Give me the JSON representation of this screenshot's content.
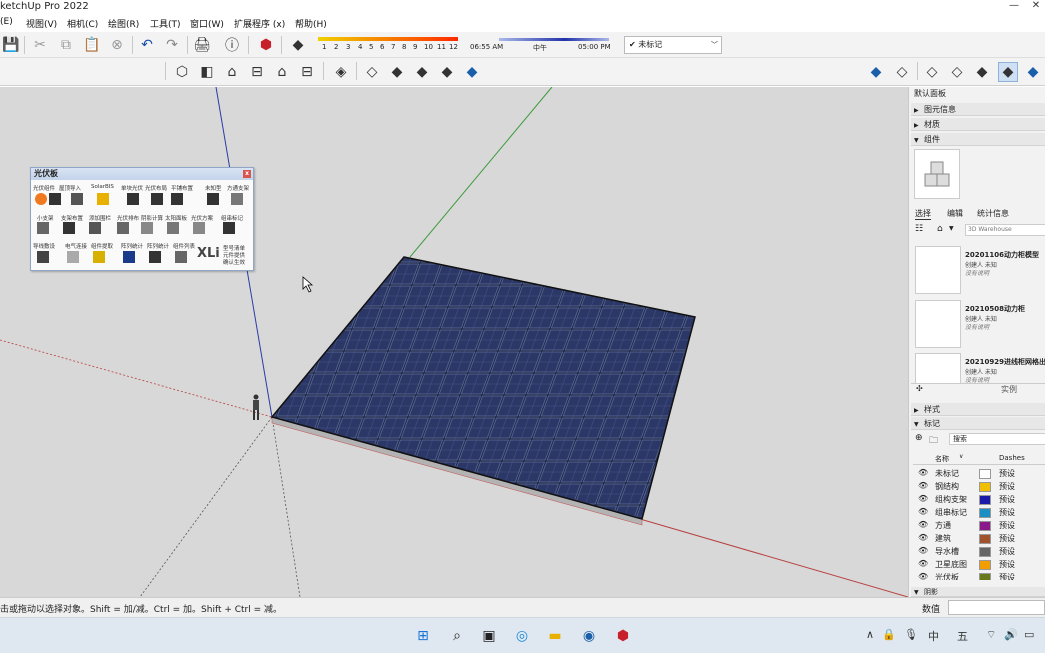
{
  "window": {
    "title": "ketchUp Pro 2022",
    "minimize": "—",
    "close": "✕"
  },
  "menu": [
    "(E)",
    "视图(V)",
    "相机(C)",
    "绘图(R)",
    "工具(T)",
    "窗口(W)",
    "扩展程序 (x)",
    "帮助(H)"
  ],
  "toolbar": {
    "months": [
      "1",
      "2",
      "3",
      "4",
      "5",
      "6",
      "7",
      "8",
      "9",
      "10",
      "11",
      "12"
    ],
    "time_start": "06:55 AM",
    "time_mid": "中午",
    "time_end": "05:00 PM",
    "tag_dropdown_value": "未标记",
    "tag_check": "✔"
  },
  "pv_panel": {
    "title": "光伏板",
    "close": "x",
    "row1_labels": [
      "光伏组件",
      "屋顶导入",
      "SolarBIS",
      "单块光伏",
      "光伏布局",
      "平铺布置",
      "未知型",
      "方通支架"
    ],
    "row2_labels": [
      "小支架",
      "支架布置",
      "添加围栏",
      "光伏排布",
      "阴影计算",
      "太阳面板",
      "光伏方案",
      "组串标记"
    ],
    "row3_labels": [
      "导线敷设",
      "电气连接",
      "组件提取",
      "阵列统计",
      "阵列统计",
      "组件列表"
    ],
    "xli_text": "XLi",
    "xli_side": [
      "型号清单",
      "元件提供",
      "确认生效"
    ]
  },
  "tray": {
    "default_tray": "默认面板",
    "entity_info": "图元信息",
    "materials": "材质",
    "components": "组件",
    "tabs": {
      "select": "选择",
      "edit": "编辑",
      "stats": "统计信息"
    },
    "search_placeholder": "3D Warehouse",
    "components_list": [
      {
        "name": "20201106动力柜模型",
        "meta": "创建人 未知",
        "desc": "没有说明"
      },
      {
        "name": "20210508动力柜",
        "meta": "创建人 未知",
        "desc": "没有说明"
      },
      {
        "name": "20210929进线柜网格出",
        "meta": "创建人 未知",
        "desc": "没有说明"
      }
    ],
    "instances": "实例",
    "styles": "样式",
    "tags": "标记",
    "tag_search": "搜索",
    "tag_col_name": "名称",
    "tag_col_dashes": "Dashes",
    "tag_rows": [
      {
        "name": "未标记",
        "color": "#ffffff",
        "dash": "预设"
      },
      {
        "name": "钢结构",
        "color": "#f0c000",
        "dash": "预设"
      },
      {
        "name": "组构支架",
        "color": "#1a1aa8",
        "dash": "预设"
      },
      {
        "name": "组串标记",
        "color": "#1a8fc4",
        "dash": "预设"
      },
      {
        "name": "方通",
        "color": "#8a1a8a",
        "dash": "预设"
      },
      {
        "name": "建筑",
        "color": "#a0522d",
        "dash": "预设"
      },
      {
        "name": "导水槽",
        "color": "#666666",
        "dash": "预设"
      },
      {
        "name": "卫星底图",
        "color": "#f29e00",
        "dash": "预设"
      },
      {
        "name": "光伏板",
        "color": "#6a7a1a",
        "dash": "预设"
      }
    ],
    "bottom_label": "阴影"
  },
  "status": {
    "hint": "击或拖动以选择对象。Shift = 加/减。Ctrl = 加。Shift + Ctrl = 减。",
    "value_label": "数值"
  },
  "taskbar": {
    "ime_cn": "中",
    "ime_mode": "五"
  }
}
